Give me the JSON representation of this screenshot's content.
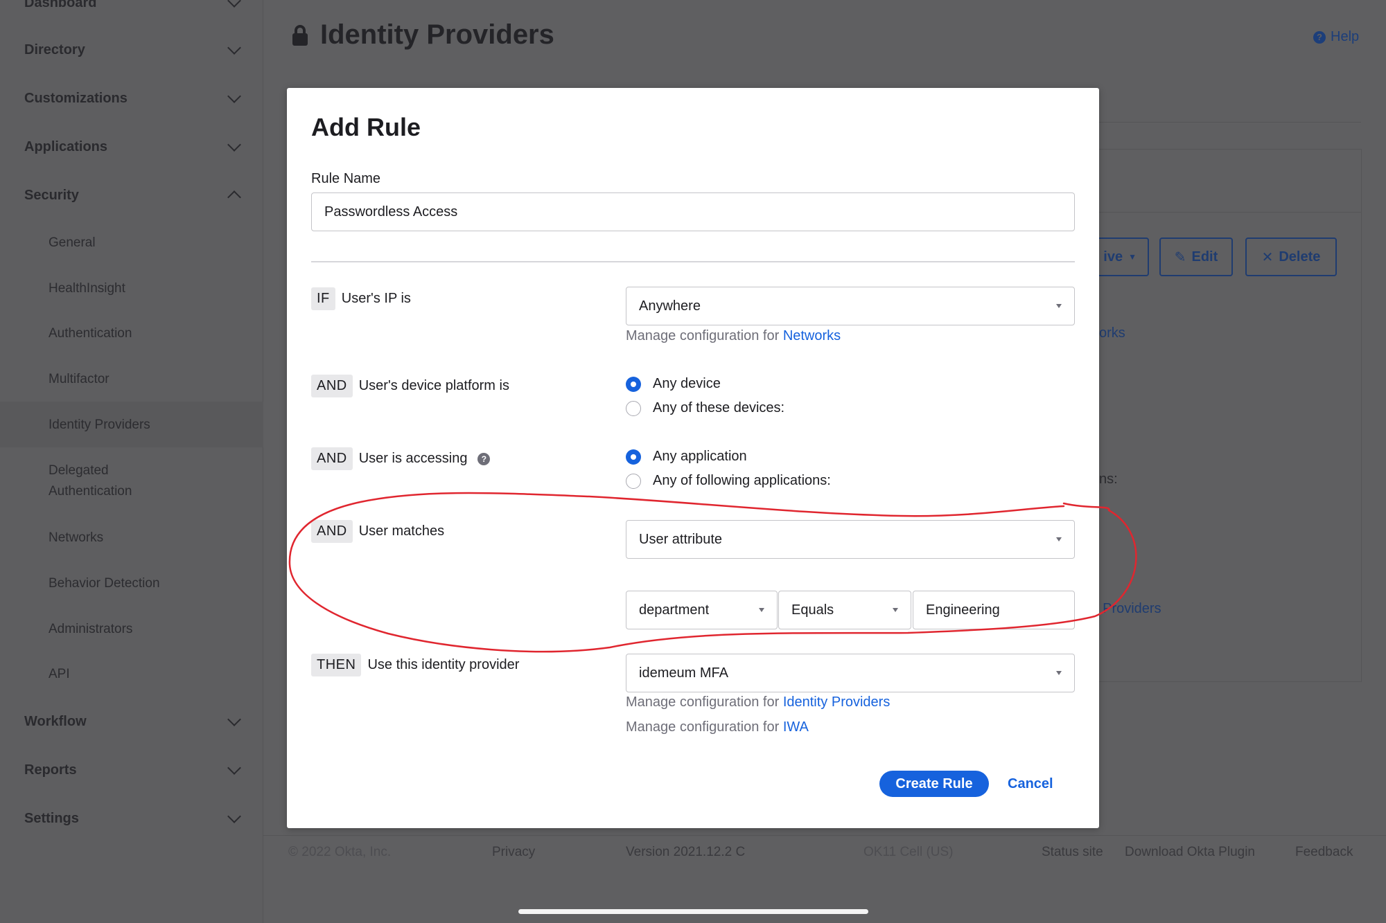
{
  "sidebar": {
    "top_item": "Dashboard",
    "sections": [
      {
        "label": "Directory"
      },
      {
        "label": "Customizations"
      },
      {
        "label": "Applications"
      },
      {
        "label": "Security"
      },
      {
        "label": "Workflow"
      },
      {
        "label": "Reports"
      },
      {
        "label": "Settings"
      }
    ],
    "security_items": [
      {
        "label": "General"
      },
      {
        "label": "HealthInsight"
      },
      {
        "label": "Authentication"
      },
      {
        "label": "Multifactor"
      },
      {
        "label": "Identity Providers"
      },
      {
        "label": "Delegated Authentication"
      },
      {
        "label": "Networks"
      },
      {
        "label": "Behavior Detection"
      },
      {
        "label": "Administrators"
      },
      {
        "label": "API"
      }
    ]
  },
  "page": {
    "title": "Identity Providers",
    "help_label": "Help"
  },
  "background_panel": {
    "status_btn_partial": "ive",
    "edit_label": "Edit",
    "delete_label": "Delete",
    "networks_partial": "orks",
    "applications_partial": "ns:",
    "idp_link_partial": "ty Providers"
  },
  "footer": {
    "copyright": "© 2022 Okta, Inc.",
    "privacy": "Privacy",
    "version": "Version 2021.12.2 C",
    "cell": "OK11 Cell (US)",
    "status_site": "Status site",
    "download_plugin": "Download Okta Plugin",
    "feedback": "Feedback"
  },
  "modal": {
    "title": "Add Rule",
    "rule_name_label": "Rule Name",
    "rule_name_value": "Passwordless Access",
    "conditions": {
      "ip": {
        "keyword": "IF",
        "label": "User's IP is",
        "selected": "Anywhere",
        "manage_prefix": "Manage configuration for",
        "manage_link": "Networks"
      },
      "device": {
        "keyword": "AND",
        "label": "User's device platform is",
        "options": [
          {
            "label": "Any device",
            "checked": true
          },
          {
            "label": "Any of these devices:",
            "checked": false
          }
        ]
      },
      "app": {
        "keyword": "AND",
        "label": "User is accessing",
        "help_glyph": "?",
        "options": [
          {
            "label": "Any application",
            "checked": true
          },
          {
            "label": "Any of following applications:",
            "checked": false
          }
        ]
      },
      "user": {
        "keyword": "AND",
        "label": "User matches",
        "selected": "User attribute",
        "attribute": "department",
        "operator": "Equals",
        "value": "Engineering"
      },
      "then": {
        "keyword": "THEN",
        "label": "Use this identity provider",
        "selected": "idemeum MFA",
        "manage_prefix": "Manage configuration for",
        "manage_link_1": "Identity Providers",
        "manage_link_2": "IWA"
      }
    },
    "create_label": "Create Rule",
    "cancel_label": "Cancel"
  },
  "colors": {
    "accent": "#1662dd",
    "annotation": "#e0262f",
    "overlay": "#5f5f61"
  }
}
